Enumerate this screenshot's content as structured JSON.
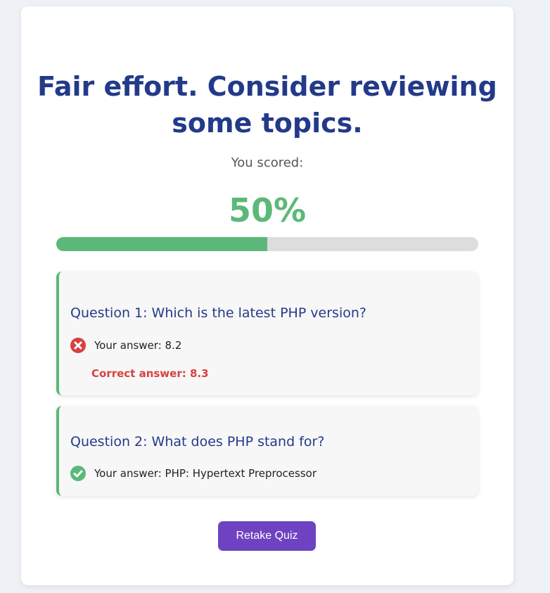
{
  "result": {
    "title": "Fair effort. Consider reviewing some topics.",
    "scored_label": "You scored:",
    "score_text": "50%",
    "score_fraction": 0.5
  },
  "questions": [
    {
      "question": "Question 1: Which is the latest PHP version?",
      "answer": "Your answer: 8.2",
      "status": "incorrect",
      "status_icon": "x-circle-icon",
      "correct_answer": "Correct answer: 8.3"
    },
    {
      "question": "Question 2: What does PHP stand for?",
      "answer": "Your answer: PHP: Hypertext Preprocessor",
      "status": "correct",
      "status_icon": "check-circle-icon"
    }
  ],
  "actions": {
    "retake_label": "Retake Quiz"
  },
  "colors": {
    "accent_green": "#5cb878",
    "title_blue": "#233a8a",
    "error_red": "#d94040",
    "button_purple": "#6f42c1"
  }
}
